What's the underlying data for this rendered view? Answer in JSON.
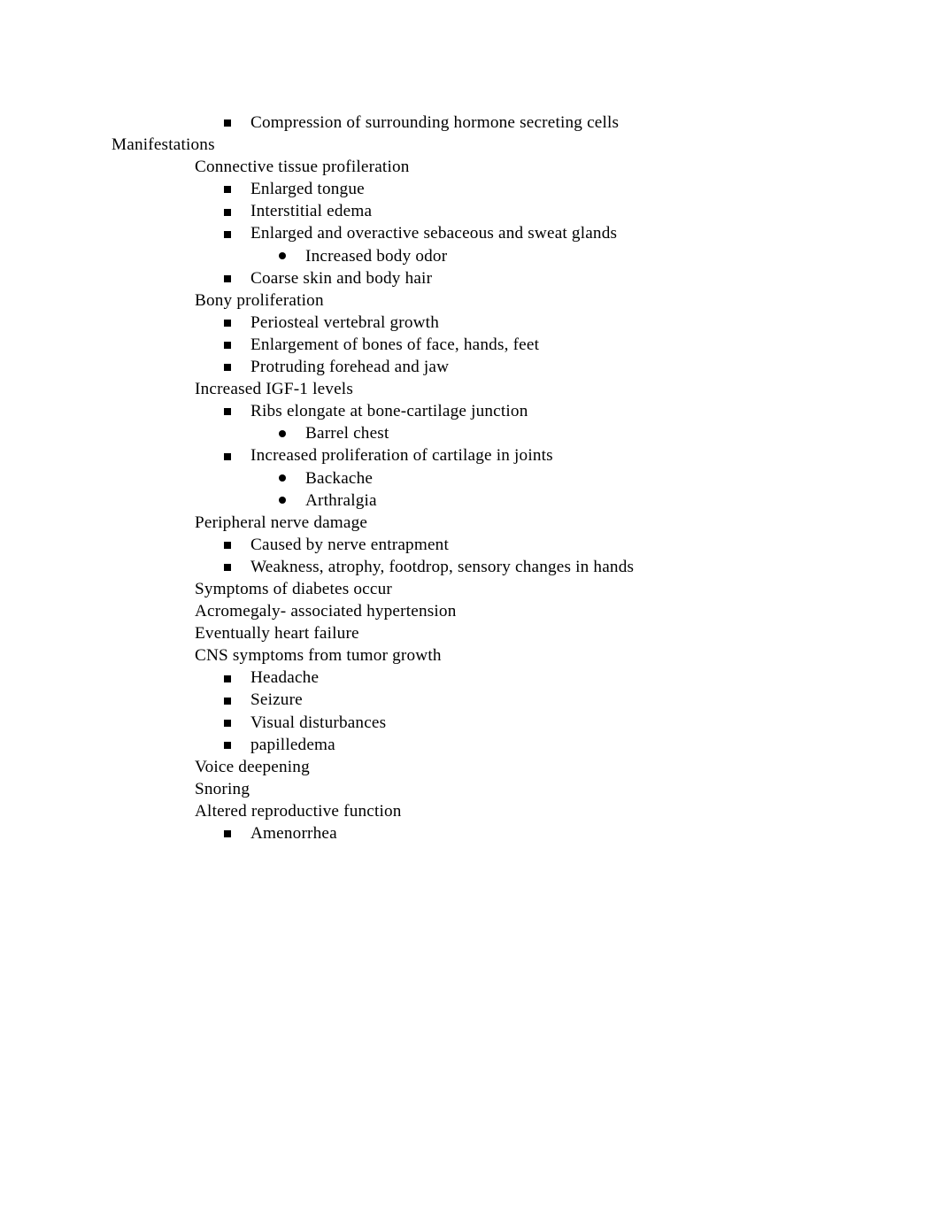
{
  "document": {
    "page_background": "#ffffff",
    "text_color": "#000000",
    "outline": [
      {
        "level": 3,
        "bullet": "square",
        "text": "Compression of surrounding hormone secreting cells"
      },
      {
        "level": 1,
        "bullet": "none",
        "text": "Manifestations"
      },
      {
        "level": 2,
        "bullet": "none",
        "text": "Connective tissue profileration"
      },
      {
        "level": 3,
        "bullet": "square",
        "text": "Enlarged tongue"
      },
      {
        "level": 3,
        "bullet": "square",
        "text": "Interstitial edema"
      },
      {
        "level": 3,
        "bullet": "square",
        "text": "Enlarged and overactive sebaceous and sweat glands"
      },
      {
        "level": 4,
        "bullet": "round",
        "text": "Increased body odor"
      },
      {
        "level": 3,
        "bullet": "square",
        "text": "Coarse skin and body hair"
      },
      {
        "level": 2,
        "bullet": "none",
        "text": "Bony proliferation"
      },
      {
        "level": 3,
        "bullet": "square",
        "text": "Periosteal vertebral growth"
      },
      {
        "level": 3,
        "bullet": "square",
        "text": "Enlargement of bones of face, hands, feet"
      },
      {
        "level": 3,
        "bullet": "square",
        "text": "Protruding forehead and jaw"
      },
      {
        "level": 2,
        "bullet": "none",
        "text": "Increased IGF-1 levels"
      },
      {
        "level": 3,
        "bullet": "square",
        "text": "Ribs elongate at bone-cartilage junction"
      },
      {
        "level": 4,
        "bullet": "round",
        "text": "Barrel chest"
      },
      {
        "level": 3,
        "bullet": "square",
        "text": "Increased proliferation of cartilage in joints"
      },
      {
        "level": 4,
        "bullet": "round",
        "text": "Backache"
      },
      {
        "level": 4,
        "bullet": "round",
        "text": "Arthralgia"
      },
      {
        "level": 2,
        "bullet": "none",
        "text": "Peripheral nerve damage"
      },
      {
        "level": 3,
        "bullet": "square",
        "text": "Caused by nerve entrapment"
      },
      {
        "level": 3,
        "bullet": "square",
        "text": "Weakness, atrophy, footdrop, sensory changes in hands"
      },
      {
        "level": 2,
        "bullet": "none",
        "text": "Symptoms of diabetes occur"
      },
      {
        "level": 2,
        "bullet": "none",
        "text": "Acromegaly- associated hypertension"
      },
      {
        "level": 2,
        "bullet": "none",
        "text": "Eventually heart failure"
      },
      {
        "level": 2,
        "bullet": "none",
        "text": "CNS symptoms from tumor growth"
      },
      {
        "level": 3,
        "bullet": "square",
        "text": "Headache"
      },
      {
        "level": 3,
        "bullet": "square",
        "text": "Seizure"
      },
      {
        "level": 3,
        "bullet": "square",
        "text": "Visual disturbances"
      },
      {
        "level": 3,
        "bullet": "square",
        "text": "papilledema"
      },
      {
        "level": 2,
        "bullet": "none",
        "text": "Voice deepening"
      },
      {
        "level": 2,
        "bullet": "none",
        "text": "Snoring"
      },
      {
        "level": 2,
        "bullet": "none",
        "text": "Altered reproductive function"
      },
      {
        "level": 3,
        "bullet": "square",
        "text": "Amenorrhea"
      }
    ]
  }
}
